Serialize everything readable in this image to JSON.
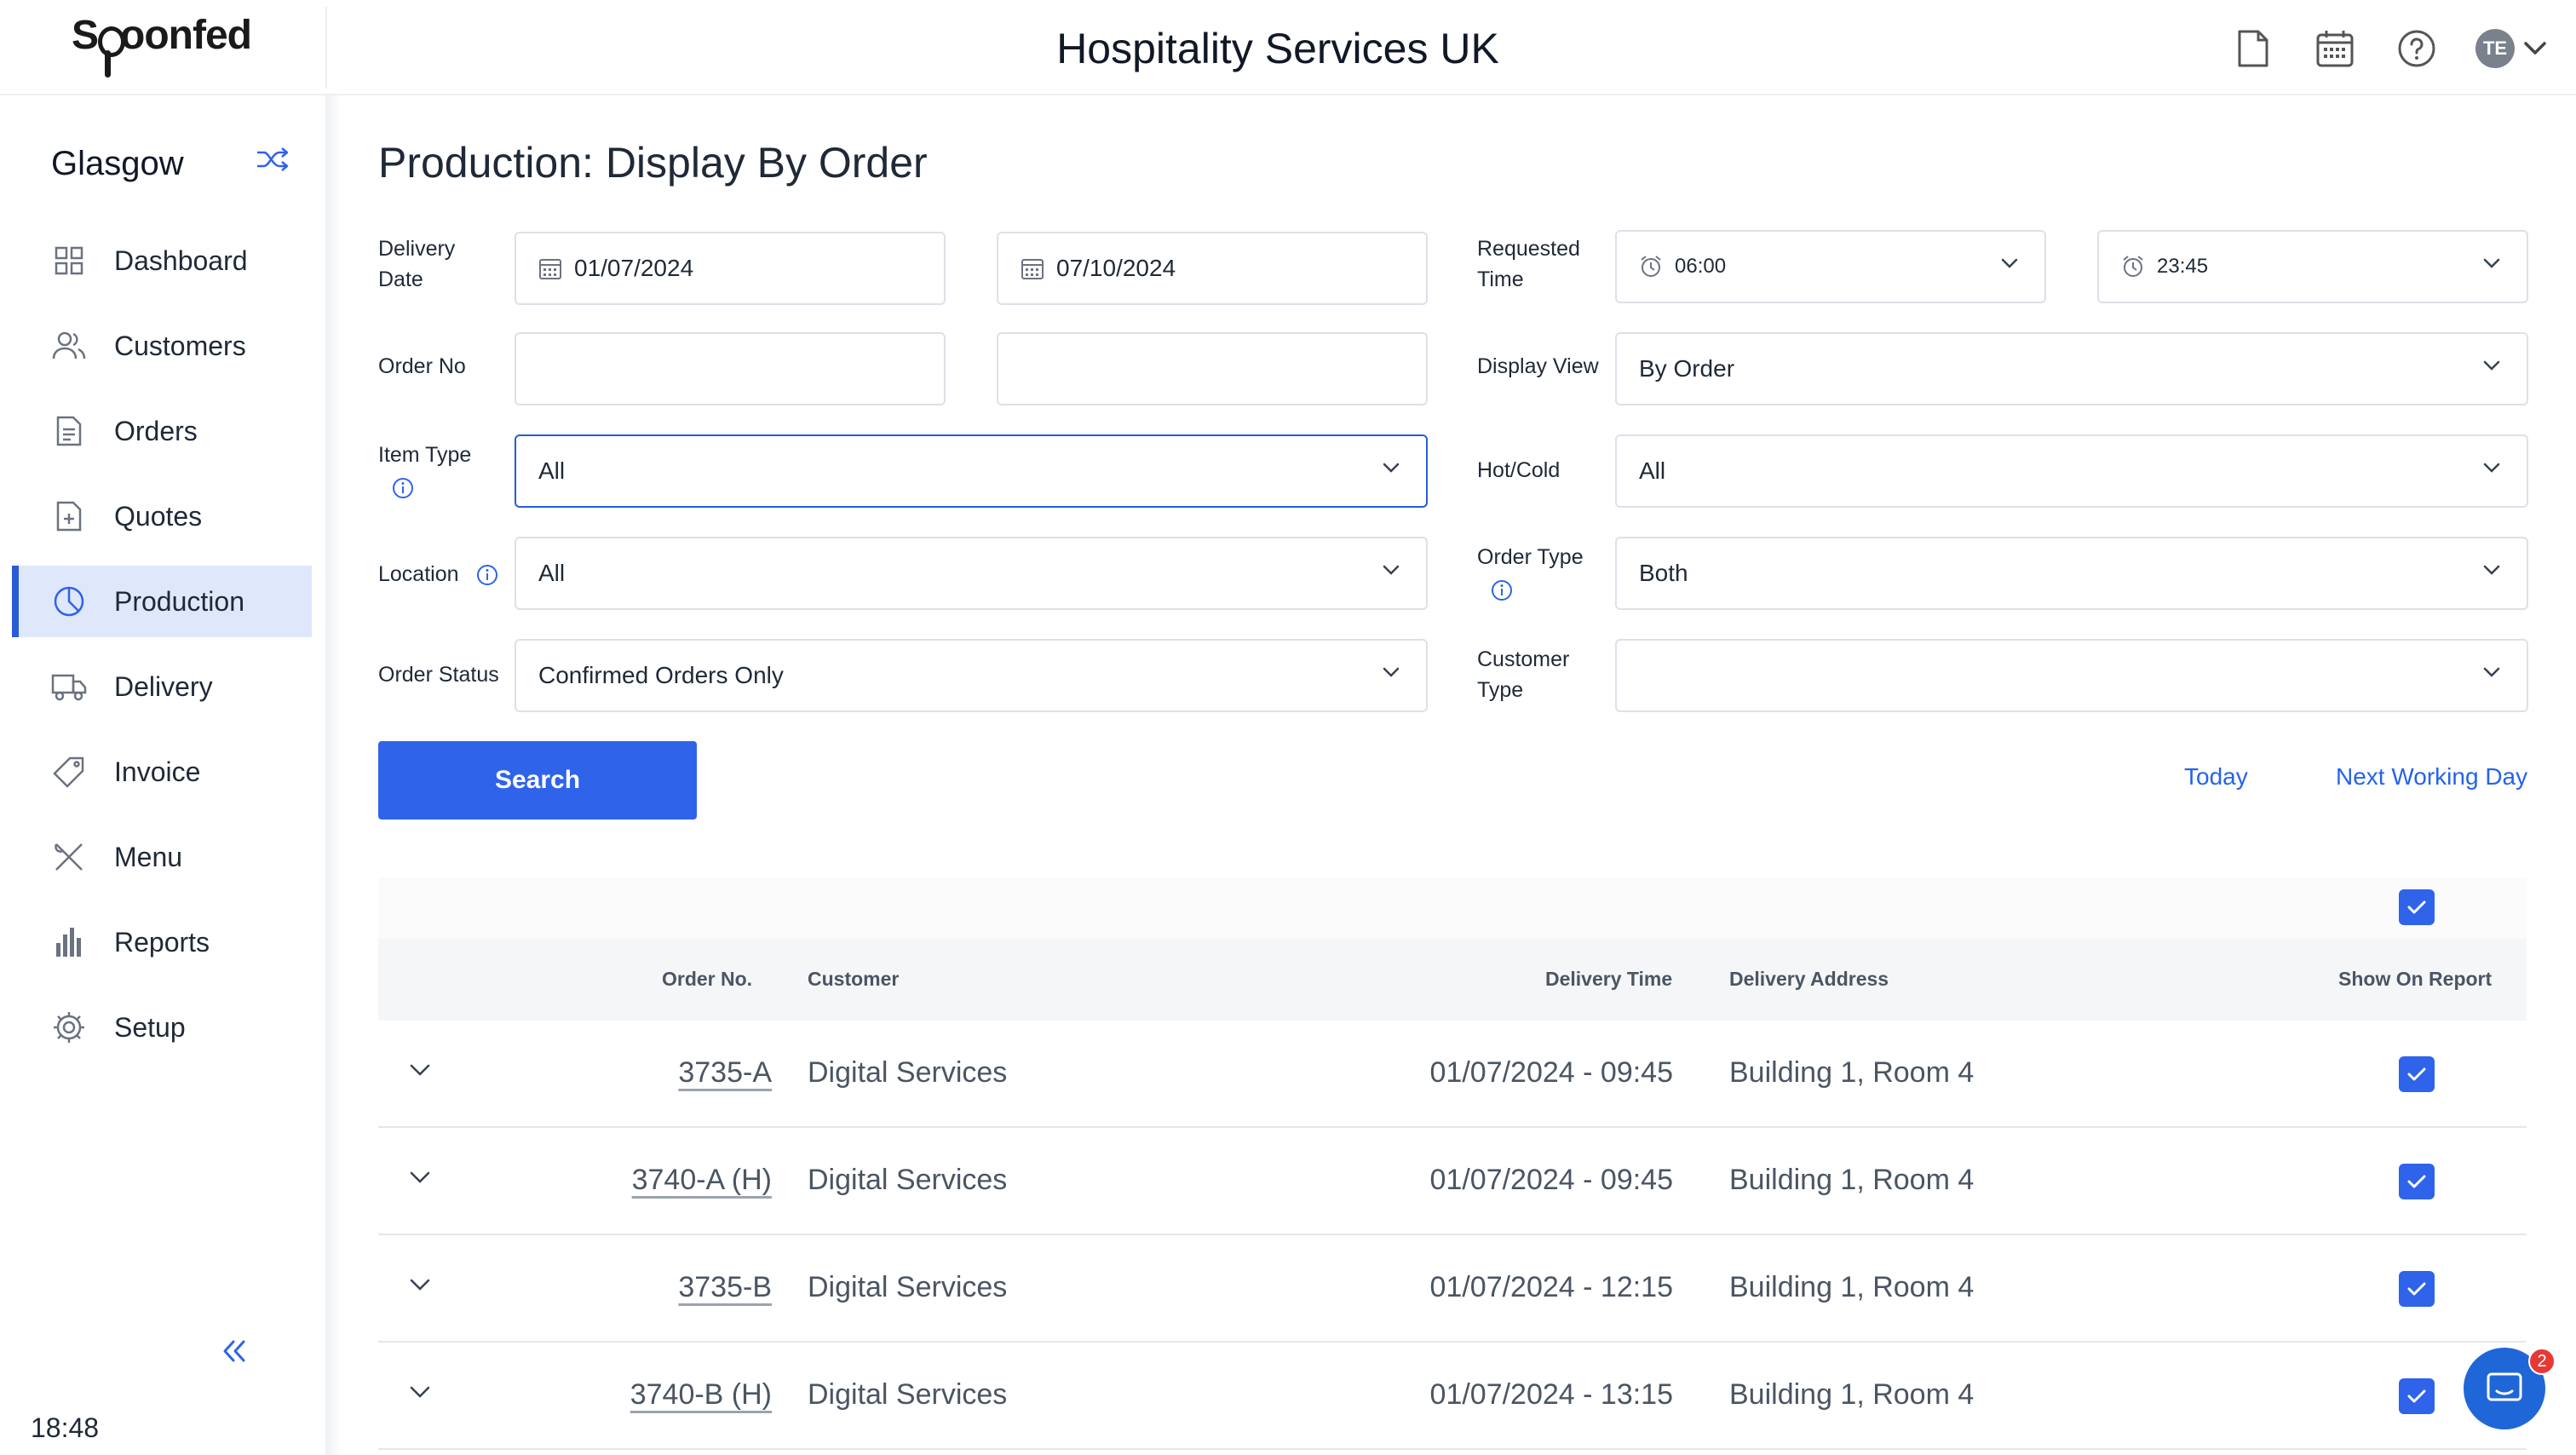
{
  "header": {
    "logo_text_a": "S",
    "logo_text_b": "oonfed",
    "title": "Hospitality Services UK",
    "icons": [
      "document-icon",
      "calendar-icon",
      "help-icon",
      "chevron-down-icon"
    ],
    "avatar_initials": "TE"
  },
  "sidebar": {
    "site_name": "Glasgow",
    "items": [
      {
        "label": "Dashboard",
        "icon": "dashboard-icon"
      },
      {
        "label": "Customers",
        "icon": "customers-icon"
      },
      {
        "label": "Orders",
        "icon": "orders-icon"
      },
      {
        "label": "Quotes",
        "icon": "quotes-icon"
      },
      {
        "label": "Production",
        "icon": "production-icon",
        "active": true
      },
      {
        "label": "Delivery",
        "icon": "delivery-icon"
      },
      {
        "label": "Invoice",
        "icon": "invoice-icon"
      },
      {
        "label": "Menu",
        "icon": "menu-icon"
      },
      {
        "label": "Reports",
        "icon": "reports-icon"
      },
      {
        "label": "Setup",
        "icon": "setup-icon"
      }
    ],
    "clock": "18:48"
  },
  "page": {
    "title": "Production: Display By Order"
  },
  "filters": {
    "delivery_date_label_1": "Delivery",
    "delivery_date_label_2": "Date",
    "date_from": "01/07/2024",
    "date_to": "07/10/2024",
    "requested_time_label_1": "Requested",
    "requested_time_label_2": "Time",
    "time_from": "06:00",
    "time_to": "23:45",
    "order_no_label": "Order No",
    "order_no_from": "",
    "order_no_to": "",
    "display_view_label": "Display View",
    "display_view_value": "By Order",
    "item_type_label": "Item Type",
    "item_type_value": "All",
    "hot_cold_label": "Hot/Cold",
    "hot_cold_value": "All",
    "location_label": "Location",
    "location_value": "All",
    "order_type_label": "Order Type",
    "order_type_value": "Both",
    "order_status_label": "Order Status",
    "order_status_value": "Confirmed Orders Only",
    "customer_type_label_1": "Customer",
    "customer_type_label_2": "Type",
    "customer_type_value": ""
  },
  "actions": {
    "search_label": "Search",
    "today_label": "Today",
    "next_working_day_label": "Next Working Day"
  },
  "table": {
    "columns": {
      "order_no": "Order No.",
      "customer": "Customer",
      "delivery_time": "Delivery Time",
      "delivery_address": "Delivery Address",
      "show_on_report": "Show On Report"
    },
    "rows": [
      {
        "order_no": "3735-A",
        "customer": "Digital Services",
        "delivery_time": "01/07/2024 - 09:45",
        "delivery_address": "Building 1, Room 4",
        "show_on_report": true
      },
      {
        "order_no": "3740-A (H)",
        "customer": "Digital Services",
        "delivery_time": "01/07/2024 - 09:45",
        "delivery_address": "Building 1, Room 4",
        "show_on_report": true
      },
      {
        "order_no": "3735-B",
        "customer": "Digital Services",
        "delivery_time": "01/07/2024 - 12:15",
        "delivery_address": "Building 1, Room 4",
        "show_on_report": true
      },
      {
        "order_no": "3740-B (H)",
        "customer": "Digital Services",
        "delivery_time": "01/07/2024 - 13:15",
        "delivery_address": "Building 1, Room 4",
        "show_on_report": true
      }
    ]
  },
  "chat": {
    "badge_count": "2"
  },
  "colors": {
    "accent": "#2e63ea",
    "active_nav_bg": "#dfe7fb",
    "link": "#2563eb"
  }
}
